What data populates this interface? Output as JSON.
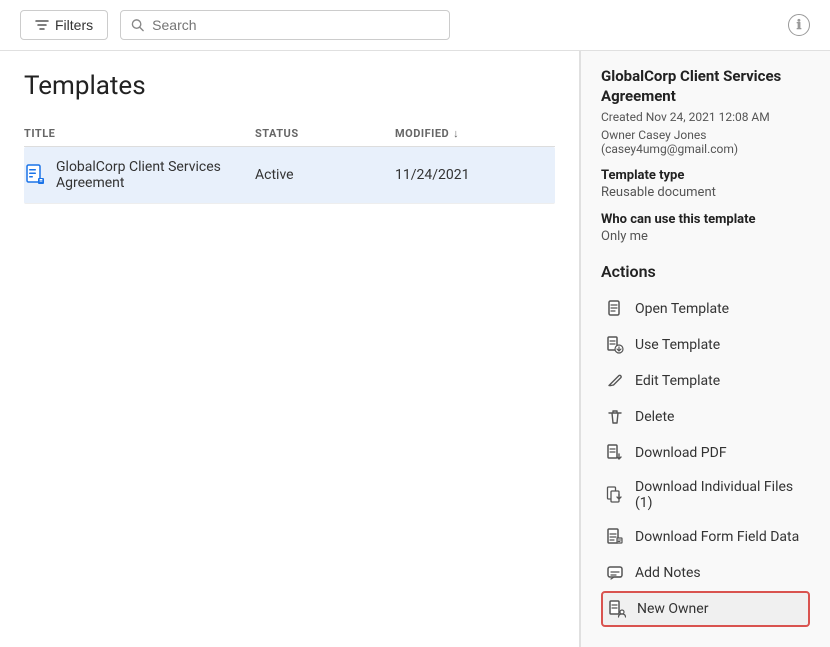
{
  "topbar": {
    "filter_label": "Filters",
    "search_placeholder": "Search",
    "info_icon": "ℹ"
  },
  "left": {
    "page_title": "Templates",
    "columns": {
      "title": "TITLE",
      "status": "STATUS",
      "modified": "MODIFIED"
    },
    "rows": [
      {
        "title": "GlobalCorp Client Services Agreement",
        "status": "Active",
        "modified": "11/24/2021"
      }
    ]
  },
  "right": {
    "detail_title": "GlobalCorp Client Services Agreement",
    "created_meta": "Created Nov 24, 2021 12:08 AM",
    "owner_meta": "Owner Casey Jones (casey4umg@gmail.com)",
    "template_type_label": "Template type",
    "template_type_value": "Reusable document",
    "who_can_use_label": "Who can use this template",
    "who_can_use_value": "Only me",
    "actions_title": "Actions",
    "actions": [
      {
        "id": "open-template",
        "label": "Open Template",
        "icon": "doc"
      },
      {
        "id": "use-template",
        "label": "Use Template",
        "icon": "doc-arrow"
      },
      {
        "id": "edit-template",
        "label": "Edit Template",
        "icon": "pencil"
      },
      {
        "id": "delete",
        "label": "Delete",
        "icon": "trash"
      },
      {
        "id": "download-pdf",
        "label": "Download PDF",
        "icon": "doc-down"
      },
      {
        "id": "download-individual",
        "label": "Download Individual Files (1)",
        "icon": "doc-down2"
      },
      {
        "id": "download-form",
        "label": "Download Form Field Data",
        "icon": "doc-table"
      },
      {
        "id": "add-notes",
        "label": "Add Notes",
        "icon": "comment"
      },
      {
        "id": "new-owner",
        "label": "New Owner",
        "icon": "doc-person",
        "highlighted": true
      }
    ]
  }
}
